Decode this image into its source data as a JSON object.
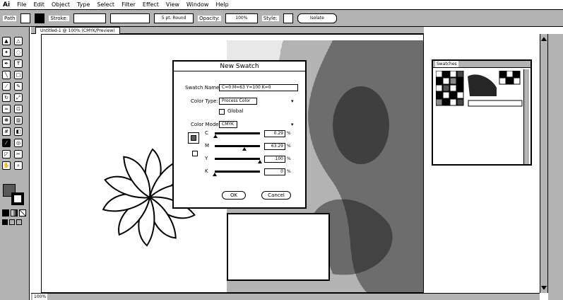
{
  "menubar": {
    "app_icon": "Ai",
    "items": [
      "File",
      "Edit",
      "Object",
      "Type",
      "Select",
      "Filter",
      "Effect",
      "View",
      "Window",
      "Help"
    ]
  },
  "controlbar": {
    "selection_label": "Path",
    "stroke_label": "Stroke:",
    "brush_value": "5 pt. Round",
    "opacity_label": "Opacity:",
    "opacity_value": "100%",
    "style_label": "Style:",
    "button_label": "Isolate"
  },
  "document": {
    "tab_title": "Untitled-1 @ 100% (CMYK/Preview)",
    "zoom": "100%"
  },
  "dialog": {
    "title": "New Swatch",
    "name_label": "Swatch Name:",
    "name_value": "C=0 M=63 Y=100 K=0",
    "type_label": "Color Type:",
    "type_value": "Process Color",
    "global_label": "Global",
    "mode_label": "Color Mode:",
    "mode_value": "CMYK",
    "channels": [
      {
        "name": "C",
        "value": "0.29"
      },
      {
        "name": "M",
        "value": "63.29"
      },
      {
        "name": "Y",
        "value": "100"
      },
      {
        "name": "K",
        "value": "0"
      }
    ],
    "percent_sign": "%",
    "ok_label": "OK",
    "cancel_label": "Cancel"
  },
  "swatches_panel": {
    "title": "Swatches"
  },
  "icons": {
    "tools": [
      "selection-tool-icon",
      "direct-selection-tool-icon",
      "magic-wand-icon",
      "lasso-icon",
      "pen-tool-icon",
      "type-tool-icon",
      "line-tool-icon",
      "rectangle-tool-icon",
      "paintbrush-icon",
      "pencil-icon",
      "rotate-tool-icon",
      "scale-tool-icon",
      "warp-tool-icon",
      "free-transform-icon",
      "symbol-sprayer-icon",
      "graph-tool-icon",
      "mesh-tool-icon",
      "gradient-tool-icon",
      "eyedropper-icon",
      "blend-tool-icon",
      "slice-tool-icon",
      "scissors-icon",
      "hand-tool-icon",
      "zoom-tool-icon"
    ]
  }
}
